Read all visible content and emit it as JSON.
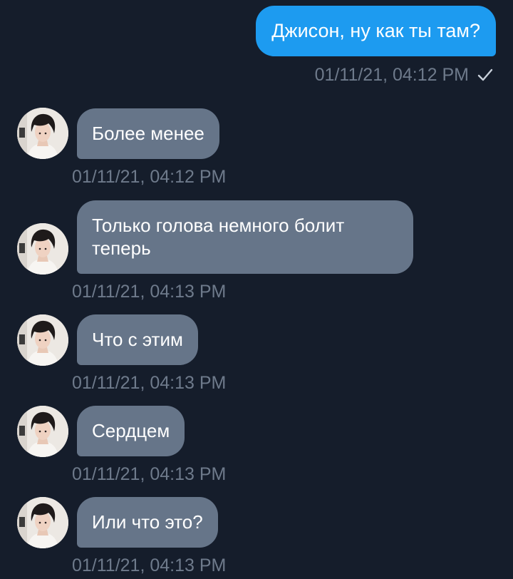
{
  "chat": {
    "outgoing": [
      {
        "text": "Джисон, ну как ты там?",
        "time": "01/11/21, 04:12 PM",
        "status_icon": "checkmark-icon"
      }
    ],
    "incoming": [
      {
        "text": "Более менее",
        "time": "01/11/21, 04:12 PM"
      },
      {
        "text": "Только голова немного болит теперь",
        "time": "01/11/21, 04:13 PM"
      },
      {
        "text": "Что с этим",
        "time": "01/11/21, 04:13 PM"
      },
      {
        "text": "Сердцем",
        "time": "01/11/21, 04:13 PM"
      },
      {
        "text": "Или что это?",
        "time": "01/11/21, 04:13 PM"
      }
    ]
  },
  "colors": {
    "background": "#151d2b",
    "outgoing_bubble": "#1d9bf0",
    "incoming_bubble": "#667589",
    "timestamp": "#6e7a8b"
  }
}
